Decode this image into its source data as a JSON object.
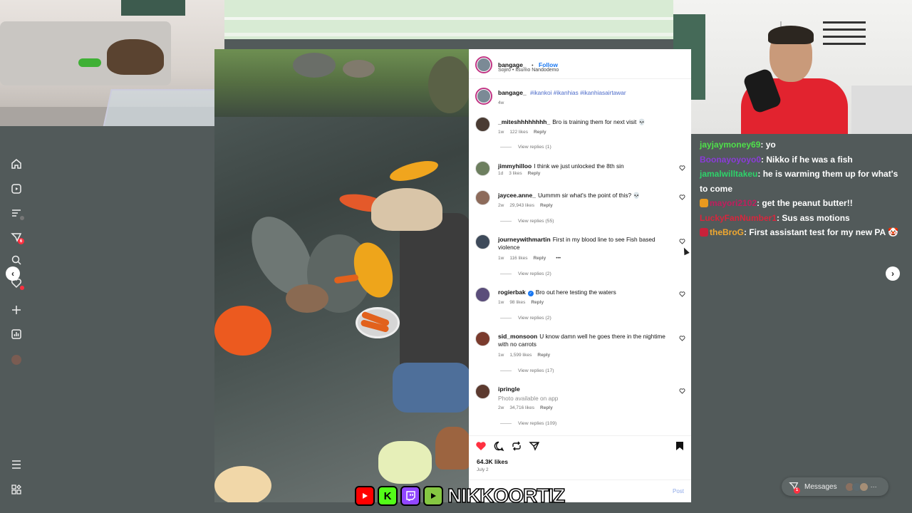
{
  "post": {
    "author": "bangage_",
    "separator": "•",
    "follow_label": "Follow",
    "audio": "Sojiro • Itsumo Nandodemo",
    "caption_tags": "#ikankoi #ikanhias #ikanhiasairtawar",
    "caption_age": "4w",
    "likes": "64.3K likes",
    "date": "July 2",
    "post_button": "Post"
  },
  "comments": [
    {
      "user": "_miteshhhhhhhh_",
      "text": "Bro is training them for next visit 💀",
      "age": "1w",
      "likes": "122 likes",
      "reply": "Reply",
      "replies": "View replies (1)",
      "avatar_color": "#4a3b33"
    },
    {
      "user": "jimmyhilloo",
      "text": "I think we just unlocked the 8th sin",
      "age": "1d",
      "likes": "3 likes",
      "reply": "Reply",
      "replies": "",
      "avatar_color": "#6d7f5f"
    },
    {
      "user": "jaycee.anne_",
      "text": "Uummm sir what's the point of this? 💀",
      "age": "2w",
      "likes": "29,943 likes",
      "reply": "Reply",
      "replies": "View replies (55)",
      "avatar_color": "#8d6b5b"
    },
    {
      "user": "journeywithmartin",
      "text": "First in my blood line to see Fish based violence",
      "age": "1w",
      "likes": "116 likes",
      "reply": "Reply",
      "more": "•••",
      "replies": "View replies (2)",
      "avatar_color": "#3e4a5a"
    },
    {
      "user": "rogierbak",
      "verified": "✓",
      "text": "Bro out here testing the waters",
      "age": "1w",
      "likes": "98 likes",
      "reply": "Reply",
      "replies": "View replies (2)",
      "avatar_color": "#5a4d7a"
    },
    {
      "user": "sid_monsoon",
      "text": "U know damn well he goes there in the nightime with no carrots",
      "age": "1w",
      "likes": "1,599 likes",
      "reply": "Reply",
      "replies": "View replies (17)",
      "avatar_color": "#7a3b2d"
    },
    {
      "user": "ipringle",
      "text": "",
      "note": "Photo available on app",
      "age": "2w",
      "likes": "34,716 likes",
      "reply": "Reply",
      "replies": "View replies (109)",
      "avatar_color": "#5c3a2f"
    }
  ],
  "chat": [
    {
      "user": "jayjaymoney69",
      "msg": ": yo",
      "color": "#4fe04a",
      "badge": ""
    },
    {
      "user": "Boonayoyoyo0",
      "msg": ": Nikko if he was a fish",
      "color": "#8a3bd8",
      "badge": ""
    },
    {
      "user": "jamalwilltakeu",
      "msg": ": he is warming them up for what's to come",
      "color": "#2ed36a",
      "badge": ""
    },
    {
      "user": "mayori2102",
      "msg": ": get the peanut butter!!",
      "color": "#c21d5e",
      "badge": "#e89a1e"
    },
    {
      "user": "LuckyFanNumber1",
      "msg": ": Sus ass motions",
      "color": "#d7263d",
      "badge": ""
    },
    {
      "user": "theBroG",
      "msg": ": First assistant test for my new PA",
      "color": "#f0a830",
      "badge": "#c8213a",
      "tail": "🤡"
    }
  ],
  "messages": {
    "label": "Messages",
    "badge": "1"
  },
  "sidebar": {
    "notif_badge": "6"
  },
  "streamer": {
    "name": "NIKKOORTIZ",
    "k_label": "K"
  },
  "colors": {
    "ig_blue": "#1877f2",
    "like_red": "#ff3040",
    "youtube": "#ff0000",
    "kick": "#53fc18",
    "twitch": "#9146ff",
    "rumble": "#85c742"
  }
}
